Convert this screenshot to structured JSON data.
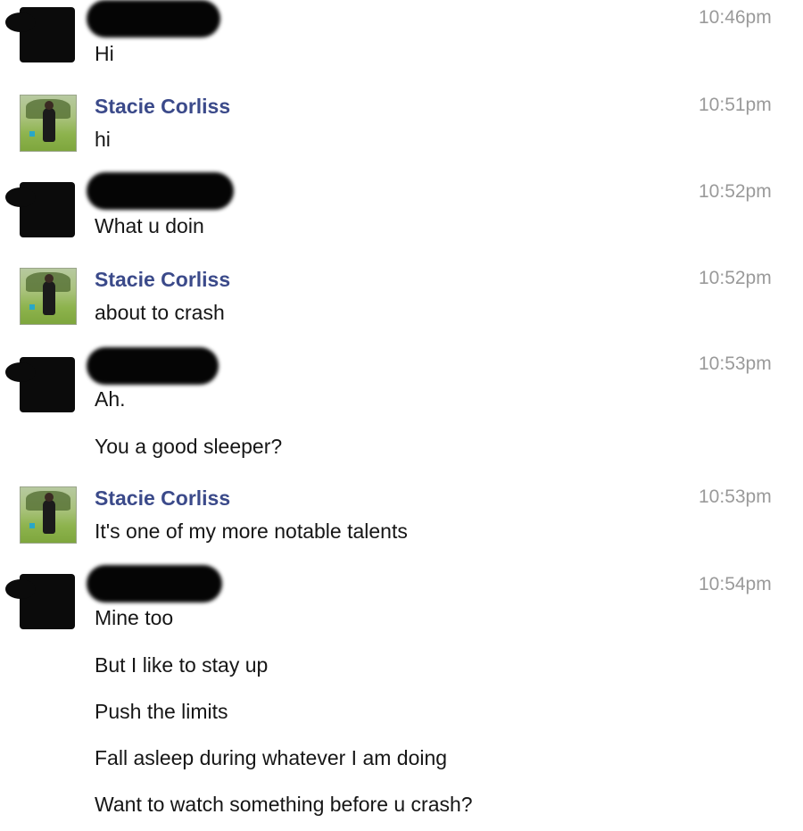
{
  "conversation": {
    "messages": [
      {
        "sender": "",
        "time": "10:46pm",
        "lines": [
          "Hi"
        ]
      },
      {
        "sender": "Stacie Corliss",
        "time": "10:51pm",
        "lines": [
          "hi"
        ]
      },
      {
        "sender": "",
        "time": "10:52pm",
        "lines": [
          "What u doin"
        ]
      },
      {
        "sender": "Stacie Corliss",
        "time": "10:52pm",
        "lines": [
          "about to crash"
        ]
      },
      {
        "sender": "",
        "time": "10:53pm",
        "lines": [
          "Ah.",
          "You a good sleeper?"
        ]
      },
      {
        "sender": "Stacie Corliss",
        "time": "10:53pm",
        "lines": [
          "It's one of my more notable talents"
        ]
      },
      {
        "sender": "",
        "time": "10:54pm",
        "lines": [
          "Mine too",
          "But I like to stay up",
          "Push the limits",
          "Fall asleep during whatever I am doing",
          "Want to watch something before u crash?"
        ]
      }
    ]
  }
}
